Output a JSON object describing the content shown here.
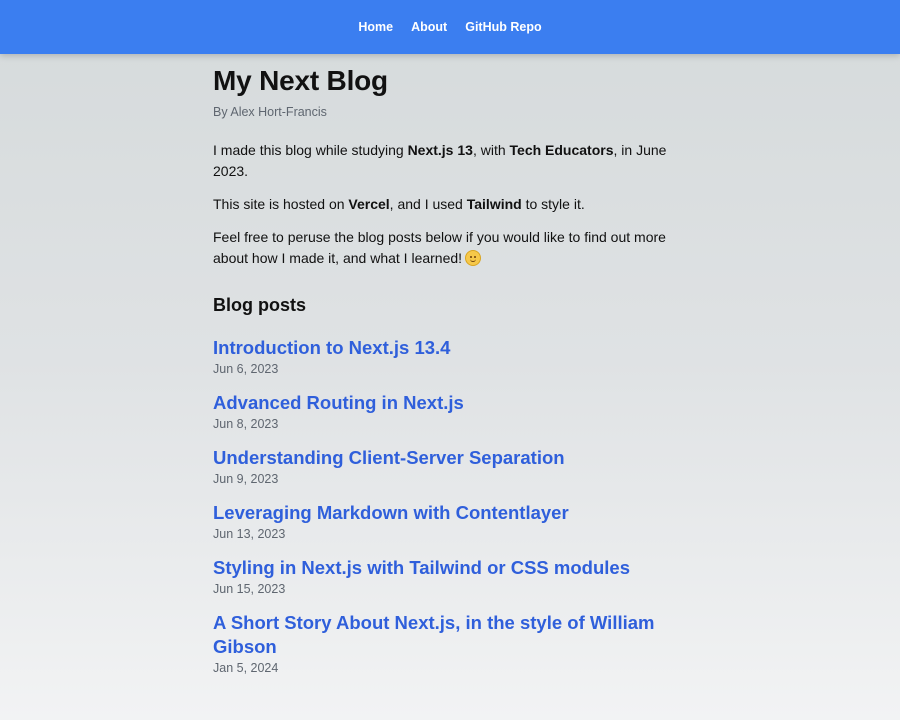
{
  "nav": {
    "links": [
      "Home",
      "About",
      "GitHub Repo"
    ]
  },
  "site": {
    "title": "My Next Blog",
    "byline": "By Alex Hort-Francis"
  },
  "intro": {
    "p1": {
      "t1": "I made this blog while studying ",
      "b1": "Next.js 13",
      "t2": ", with ",
      "b2": "Tech Educators",
      "t3": ", in June 2023."
    },
    "p2": {
      "t1": "This site is hosted on ",
      "b1": "Vercel",
      "t2": ", and I used ",
      "b2": "Tailwind",
      "t3": " to style it."
    },
    "p3": {
      "t1": "Feel free to peruse the blog posts below if you would like to find out more about how I made it, and what I learned!",
      "emoji": "smiling-face-icon"
    }
  },
  "posts_section": {
    "heading": "Blog posts",
    "posts": [
      {
        "title": "Introduction to Next.js 13.4",
        "date": "Jun 6, 2023"
      },
      {
        "title": "Advanced Routing in Next.js",
        "date": "Jun 8, 2023"
      },
      {
        "title": "Understanding Client-Server Separation",
        "date": "Jun 9, 2023"
      },
      {
        "title": "Leveraging Markdown with Contentlayer",
        "date": "Jun 13, 2023"
      },
      {
        "title": "Styling in Next.js with Tailwind or CSS modules",
        "date": "Jun 15, 2023"
      },
      {
        "title": "A Short Story About Next.js, in the style of William Gibson",
        "date": "Jan 5, 2024"
      }
    ]
  },
  "colors": {
    "navbar": "#3b7ef0",
    "link": "#2f5fdb",
    "muted": "#5f6670"
  }
}
